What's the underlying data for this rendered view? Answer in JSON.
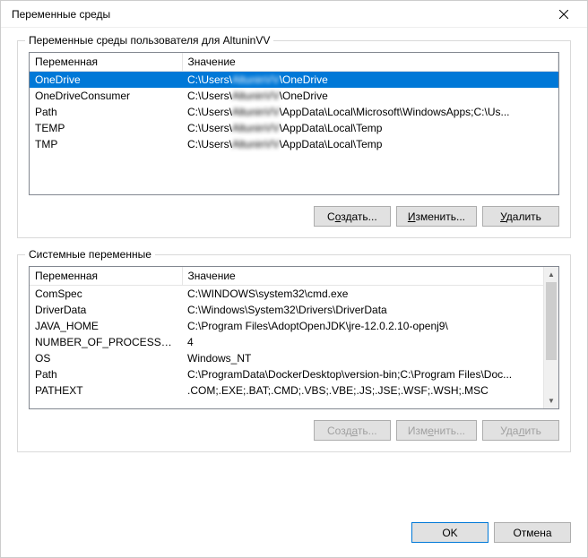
{
  "window": {
    "title": "Переменные среды",
    "close": "×"
  },
  "user_group": {
    "label": "Переменные среды пользователя для AltuninVV",
    "col_var": "Переменная",
    "col_val": "Значение",
    "rows": [
      {
        "name": "OneDrive",
        "prefix": "C:\\Users\\",
        "hidden": "AltuninVV",
        "suffix": "\\OneDrive",
        "selected": true
      },
      {
        "name": "OneDriveConsumer",
        "prefix": "C:\\Users\\",
        "hidden": "AltuninVV",
        "suffix": "\\OneDrive"
      },
      {
        "name": "Path",
        "prefix": "C:\\Users\\",
        "hidden": "AltuninVV",
        "suffix": "\\AppData\\Local\\Microsoft\\WindowsApps;C:\\Us..."
      },
      {
        "name": "TEMP",
        "prefix": "C:\\Users\\",
        "hidden": "AltuninVV",
        "suffix": "\\AppData\\Local\\Temp"
      },
      {
        "name": "TMP",
        "prefix": "C:\\Users\\",
        "hidden": "AltuninVV",
        "suffix": "\\AppData\\Local\\Temp"
      }
    ],
    "btn_new_pre": "С",
    "btn_new_u": "о",
    "btn_new_post": "здать...",
    "btn_edit_pre": "",
    "btn_edit_u": "И",
    "btn_edit_post": "зменить...",
    "btn_del_pre": "",
    "btn_del_u": "У",
    "btn_del_post": "далить"
  },
  "system_group": {
    "label": "Системные переменные",
    "col_var": "Переменная",
    "col_val": "Значение",
    "rows": [
      {
        "name": "ComSpec",
        "value": "C:\\WINDOWS\\system32\\cmd.exe"
      },
      {
        "name": "DriverData",
        "value": "C:\\Windows\\System32\\Drivers\\DriverData"
      },
      {
        "name": "JAVA_HOME",
        "value": "C:\\Program Files\\AdoptOpenJDK\\jre-12.0.2.10-openj9\\"
      },
      {
        "name": "NUMBER_OF_PROCESSORS",
        "value": "4"
      },
      {
        "name": "OS",
        "value": "Windows_NT"
      },
      {
        "name": "Path",
        "value": "C:\\ProgramData\\DockerDesktop\\version-bin;C:\\Program Files\\Doc..."
      },
      {
        "name": "PATHEXT",
        "value": ".COM;.EXE;.BAT;.CMD;.VBS;.VBE;.JS;.JSE;.WSF;.WSH;.MSC"
      }
    ],
    "btn_new_pre": "Созд",
    "btn_new_u": "а",
    "btn_new_post": "ть...",
    "btn_edit_pre": "Изм",
    "btn_edit_u": "е",
    "btn_edit_post": "нить...",
    "btn_del_pre": "Уда",
    "btn_del_u": "л",
    "btn_del_post": "ить"
  },
  "footer": {
    "ok": "OK",
    "cancel": "Отмена"
  }
}
